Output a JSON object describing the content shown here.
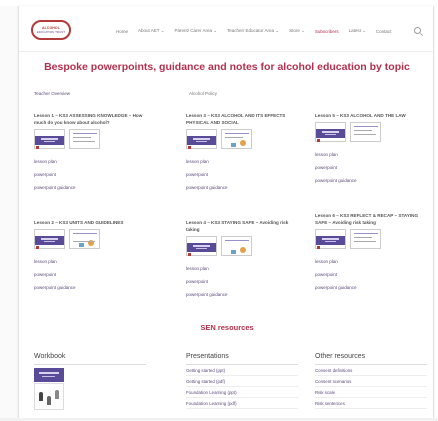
{
  "header": {
    "logo_line1": "ALCOHOL",
    "logo_line2": "EDUCATION TRUST",
    "nav": [
      {
        "label": "Home",
        "active": false
      },
      {
        "label": "About AET ⌄",
        "active": false
      },
      {
        "label": "Parent/ Carer Area ⌄",
        "active": false
      },
      {
        "label": "Teacher/ Educator Area ⌄",
        "active": false
      },
      {
        "label": "Store ⌄",
        "active": false
      },
      {
        "label": "Subscribers",
        "active": true
      },
      {
        "label": "Latest ⌄",
        "active": false
      },
      {
        "label": "Contact",
        "active": false
      }
    ]
  },
  "page_title": "Bespoke powerpoints, guidance and notes for alcohol education by topic",
  "sub_links": {
    "teacher_overview": "Teacher Overview",
    "alcohol_policy": "Alcohol Policy"
  },
  "lessons": [
    {
      "title": "Lesson 1 – KS3 ASSESSING KNOWLEDGE – How much do you know about alcohol?",
      "links": [
        "lesson plan",
        "powerpoint",
        "powerpoint guidance"
      ]
    },
    {
      "title": "Lesson 3 – KS3 ALCOHOL AND ITS EFFECTS PHYSICAL AND SOCIAL",
      "links": [
        "lesson plan",
        "powerpoint",
        "powerpoint guidance"
      ]
    },
    {
      "title": "Lesson 5 – KS3 ALCOHOL AND THE LAW",
      "links": [
        "lesson plan",
        "powerpoint",
        "powerpoint guidance"
      ]
    },
    {
      "title": "Lesson 2 – KS3 UNITS AND GUIDELINES",
      "links": [
        "lesson plan",
        "powerpoint",
        "powerpoint guidance"
      ]
    },
    {
      "title": "Lesson 4 – KS3 STAYING SAFE – Avoiding risk taking",
      "links": [
        "lesson plan",
        "powerpoint",
        "powerpoint guidance"
      ]
    },
    {
      "title": "Lesson 6 – KS3 REFLECT & RECAP – STAYING SAFE – Avoiding risk taking",
      "links": [
        "lesson plan",
        "powerpoint",
        "powerpoint guidance"
      ]
    }
  ],
  "sen_title": "SEN resources",
  "sen": {
    "workbook": {
      "heading": "Workbook"
    },
    "presentations": {
      "heading": "Presentations",
      "items": [
        "Getting started (ppt)",
        "Getting started (pdf)",
        "Foundation Learning (ppt)",
        "Foundation Learning (pdf)"
      ]
    },
    "other": {
      "heading": "Other resources",
      "items": [
        "Consent definitions",
        "Consent scenarios",
        "Risk scale",
        "Risk sentences"
      ]
    }
  },
  "colors": {
    "brand": "#b4314e",
    "link": "#5c4a7c",
    "thumb": "#5a4b98"
  }
}
